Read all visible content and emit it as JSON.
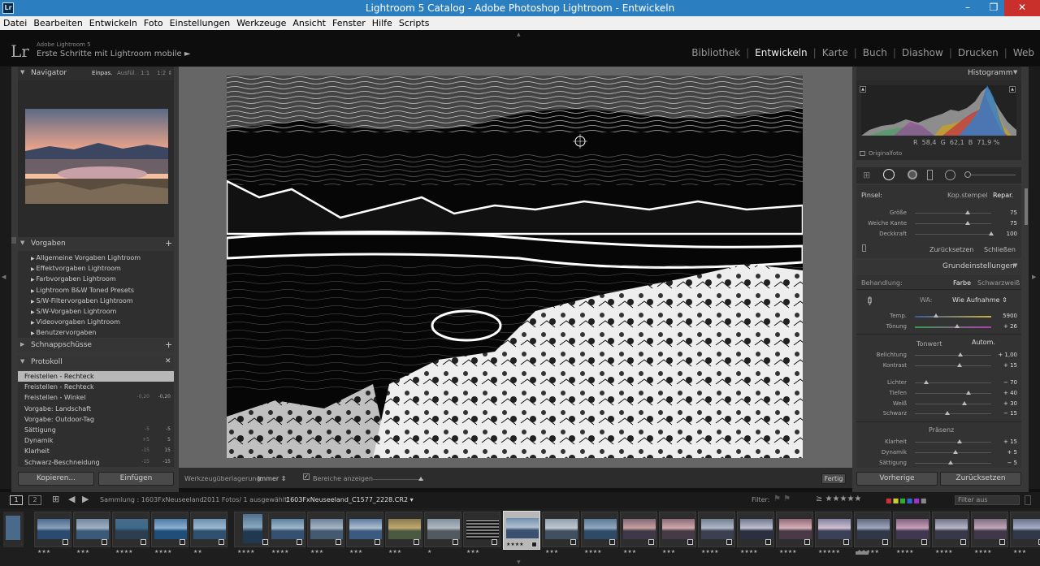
{
  "window": {
    "title": "Lightroom 5 Catalog - Adobe Photoshop Lightroom - Entwickeln",
    "app_icon": "Lr"
  },
  "menu": [
    "Datei",
    "Bearbeiten",
    "Entwickeln",
    "Foto",
    "Einstellungen",
    "Werkzeuge",
    "Ansicht",
    "Fenster",
    "Hilfe",
    "Scripts"
  ],
  "identity": {
    "logo": "Lr",
    "product": "Adobe Lightroom 5",
    "subtitle": "Erste Schritte mit Lightroom mobile ►"
  },
  "modules": {
    "items": [
      "Bibliothek",
      "Entwickeln",
      "Karte",
      "Buch",
      "Diashow",
      "Drucken",
      "Web"
    ],
    "active": "Entwickeln"
  },
  "navigator": {
    "title": "Navigator",
    "zoom": [
      "Einpas.",
      "Ausfül.",
      "1:1",
      "1:2 ⇕"
    ]
  },
  "presets": {
    "title": "Vorgaben",
    "items": [
      "Allgemeine Vorgaben Lightroom",
      "Effektvorgaben Lightroom",
      "Farbvorgaben Lightroom",
      "Lightroom B&W Toned Presets",
      "S/W-Filtervorgaben Lightroom",
      "S/W-Vorgaben Lightroom",
      "Videovorgaben Lightroom",
      "Benutzervorgaben"
    ]
  },
  "snapshots": {
    "title": "Schnappschüsse"
  },
  "history": {
    "title": "Protokoll",
    "rows": [
      {
        "name": "Freistellen - Rechteck",
        "a": "",
        "b": "",
        "selected": true
      },
      {
        "name": "Freistellen - Rechteck",
        "a": "",
        "b": ""
      },
      {
        "name": "Freistellen - Winkel",
        "a": "-0,20",
        "b": "-0,20"
      },
      {
        "name": "Vorgabe: Landschaft",
        "a": "",
        "b": ""
      },
      {
        "name": "Vorgabe: Outdoor-Tag",
        "a": "",
        "b": ""
      },
      {
        "name": "Sättigung",
        "a": "-5",
        "b": "-5"
      },
      {
        "name": "Dynamik",
        "a": "+5",
        "b": "5"
      },
      {
        "name": "Klarheit",
        "a": "-15",
        "b": "15"
      },
      {
        "name": "Schwarz-Beschneidung",
        "a": "-15",
        "b": "-15"
      }
    ]
  },
  "left_buttons": {
    "copy": "Kopieren...",
    "paste": "Einfügen"
  },
  "toolbar": {
    "overlay_label": "Werkzeugüberlagerung:",
    "overlay_value": "Immer ⇕",
    "show_areas": "Bereiche anzeigen",
    "done": "Fertig"
  },
  "histogram": {
    "title": "Histogramm",
    "r_label": "R",
    "r": "58,4",
    "g_label": "G",
    "g": "62,1",
    "b_label": "B",
    "b": "71,9",
    "unit": "%",
    "original": "Originalfoto"
  },
  "spot": {
    "brush_label": "Pinsel:",
    "clone": "Kop.stempel",
    "heal": "Repar.",
    "sliders": [
      {
        "label": "Größe",
        "value": "75",
        "pos": 0.69
      },
      {
        "label": "Weiche Kante",
        "value": "75",
        "pos": 0.69
      },
      {
        "label": "Deckkraft",
        "value": "100",
        "pos": 1.0
      }
    ],
    "reset": "Zurücksetzen",
    "close": "Schließen"
  },
  "basic": {
    "title": "Grundeinstellungen",
    "treatment_label": "Behandlung:",
    "color": "Farbe",
    "bw": "Schwarzweiß",
    "wb_label": "WA:",
    "wb_value": "Wie Aufnahme ⇕",
    "wb_sliders": [
      {
        "label": "Temp.",
        "value": "5900",
        "pos": 0.28
      },
      {
        "label": "Tönung",
        "value": "+ 26",
        "pos": 0.55
      }
    ],
    "tone_label": "Tonwert",
    "auto": "Autom.",
    "tone_sliders": [
      {
        "label": "Belichtung",
        "value": "+ 1,00",
        "pos": 0.6
      },
      {
        "label": "Kontrast",
        "value": "+ 15",
        "pos": 0.58
      }
    ],
    "tone2_sliders": [
      {
        "label": "Lichter",
        "value": "− 70",
        "pos": 0.15
      },
      {
        "label": "Tiefen",
        "value": "+ 40",
        "pos": 0.7
      },
      {
        "label": "Weiß",
        "value": "+ 30",
        "pos": 0.65
      },
      {
        "label": "Schwarz",
        "value": "− 15",
        "pos": 0.43
      }
    ],
    "presence_label": "Präsenz",
    "presence_sliders": [
      {
        "label": "Klarheit",
        "value": "+ 15",
        "pos": 0.58
      },
      {
        "label": "Dynamik",
        "value": "+ 5",
        "pos": 0.53
      },
      {
        "label": "Sättigung",
        "value": "− 5",
        "pos": 0.47
      }
    ]
  },
  "right_buttons": {
    "prev": "Vorherige",
    "reset": "Zurücksetzen"
  },
  "filmstrip": {
    "page1": "1",
    "page2": "2",
    "source": "Sammlung : 1603FxNeuseeland",
    "count": "2011 Fotos/ 1 ausgewählt/",
    "filename": "1603FxNeuseeland_C1577_2228.CR2 ▾",
    "filter_label": "Filter:",
    "filter_value": "Filter aus",
    "thumbs": [
      {
        "stars": "★★★"
      },
      {
        "stars": "★★★"
      },
      {
        "stars": "★★★★"
      },
      {
        "stars": "★★★★"
      },
      {
        "stars": "★★"
      },
      {
        "stars": "★★★★"
      },
      {
        "stars": "★★★★"
      },
      {
        "stars": "★★★"
      },
      {
        "stars": "★★★"
      },
      {
        "stars": "★★★"
      },
      {
        "stars": "★"
      },
      {
        "stars": "★★★"
      },
      {
        "stars": "★★★★"
      },
      {
        "stars": "★★★"
      },
      {
        "stars": "★★★★"
      },
      {
        "stars": "★★★"
      },
      {
        "stars": "★★★"
      },
      {
        "stars": "★★★★"
      },
      {
        "stars": "★★★★"
      },
      {
        "stars": "★★★★"
      },
      {
        "stars": "★★★★★"
      },
      {
        "stars": "★★★★★"
      },
      {
        "stars": "★★★★"
      },
      {
        "stars": "★★★★"
      },
      {
        "stars": "★★★★"
      },
      {
        "stars": "★★★"
      }
    ]
  }
}
